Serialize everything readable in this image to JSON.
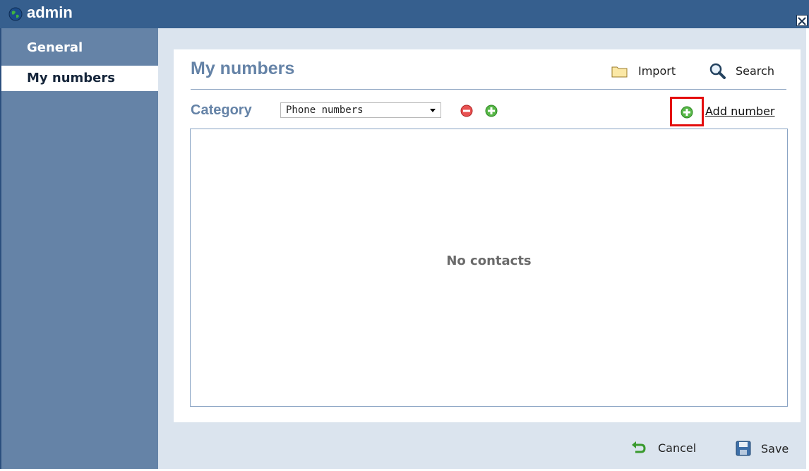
{
  "window": {
    "title": "admin"
  },
  "sidebar": {
    "items": [
      {
        "label": "General"
      },
      {
        "label": "My numbers"
      }
    ]
  },
  "panel": {
    "title": "My numbers",
    "import_label": "Import",
    "search_label": "Search"
  },
  "category": {
    "label": "Category",
    "selected": "Phone numbers",
    "add_number_label": "Add number"
  },
  "list": {
    "empty_text": "No contacts"
  },
  "footer": {
    "cancel_label": "Cancel",
    "save_label": "Save"
  },
  "colors": {
    "titlebar": "#365f8e",
    "sidebar": "#6583a7",
    "heading": "#6583a7",
    "highlight": "#e40e0e"
  }
}
